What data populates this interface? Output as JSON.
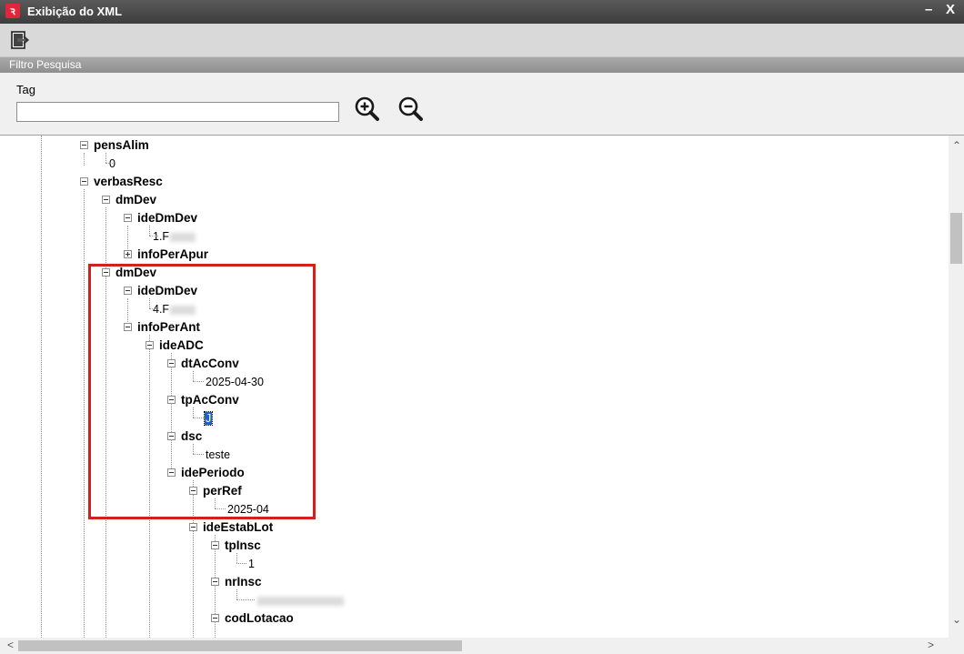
{
  "window": {
    "title": "Exibição do XML",
    "logo_glyph": "ꝛ",
    "minimize": "–",
    "close": "X"
  },
  "toolbar": {
    "exit_icon": "exit-icon"
  },
  "filter": {
    "header": "Filtro Pesquisa",
    "tag_label": "Tag",
    "tag_value": "",
    "zoom_in_icon": "zoom-in-icon",
    "zoom_out_icon": "zoom-out-icon"
  },
  "tree": {
    "nodes": [
      {
        "label": "pensAlim"
      },
      {
        "value": "0"
      },
      {
        "label": "verbasResc"
      },
      {
        "label": "dmDev"
      },
      {
        "label": "ideDmDev"
      },
      {
        "value": "1.F"
      },
      {
        "label": "infoPerApur"
      },
      {
        "label": "dmDev"
      },
      {
        "label": "ideDmDev"
      },
      {
        "value": "4.F"
      },
      {
        "label": "infoPerAnt"
      },
      {
        "label": "ideADC"
      },
      {
        "label": "dtAcConv"
      },
      {
        "value": "2025-04-30"
      },
      {
        "label": "tpAcConv"
      },
      {
        "value": "J"
      },
      {
        "label": "dsc"
      },
      {
        "value": "teste"
      },
      {
        "label": "idePeriodo"
      },
      {
        "label": "perRef"
      },
      {
        "value": "2025-04"
      },
      {
        "label": "ideEstabLot"
      },
      {
        "label": "tpInsc"
      },
      {
        "value": "1"
      },
      {
        "label": "nrInsc"
      },
      {
        "value": ""
      },
      {
        "label": "codLotacao"
      }
    ]
  },
  "colors": {
    "titlebar": "#3d3d3d",
    "highlight_box": "#d41f1f",
    "selection": "#1c63c9"
  }
}
